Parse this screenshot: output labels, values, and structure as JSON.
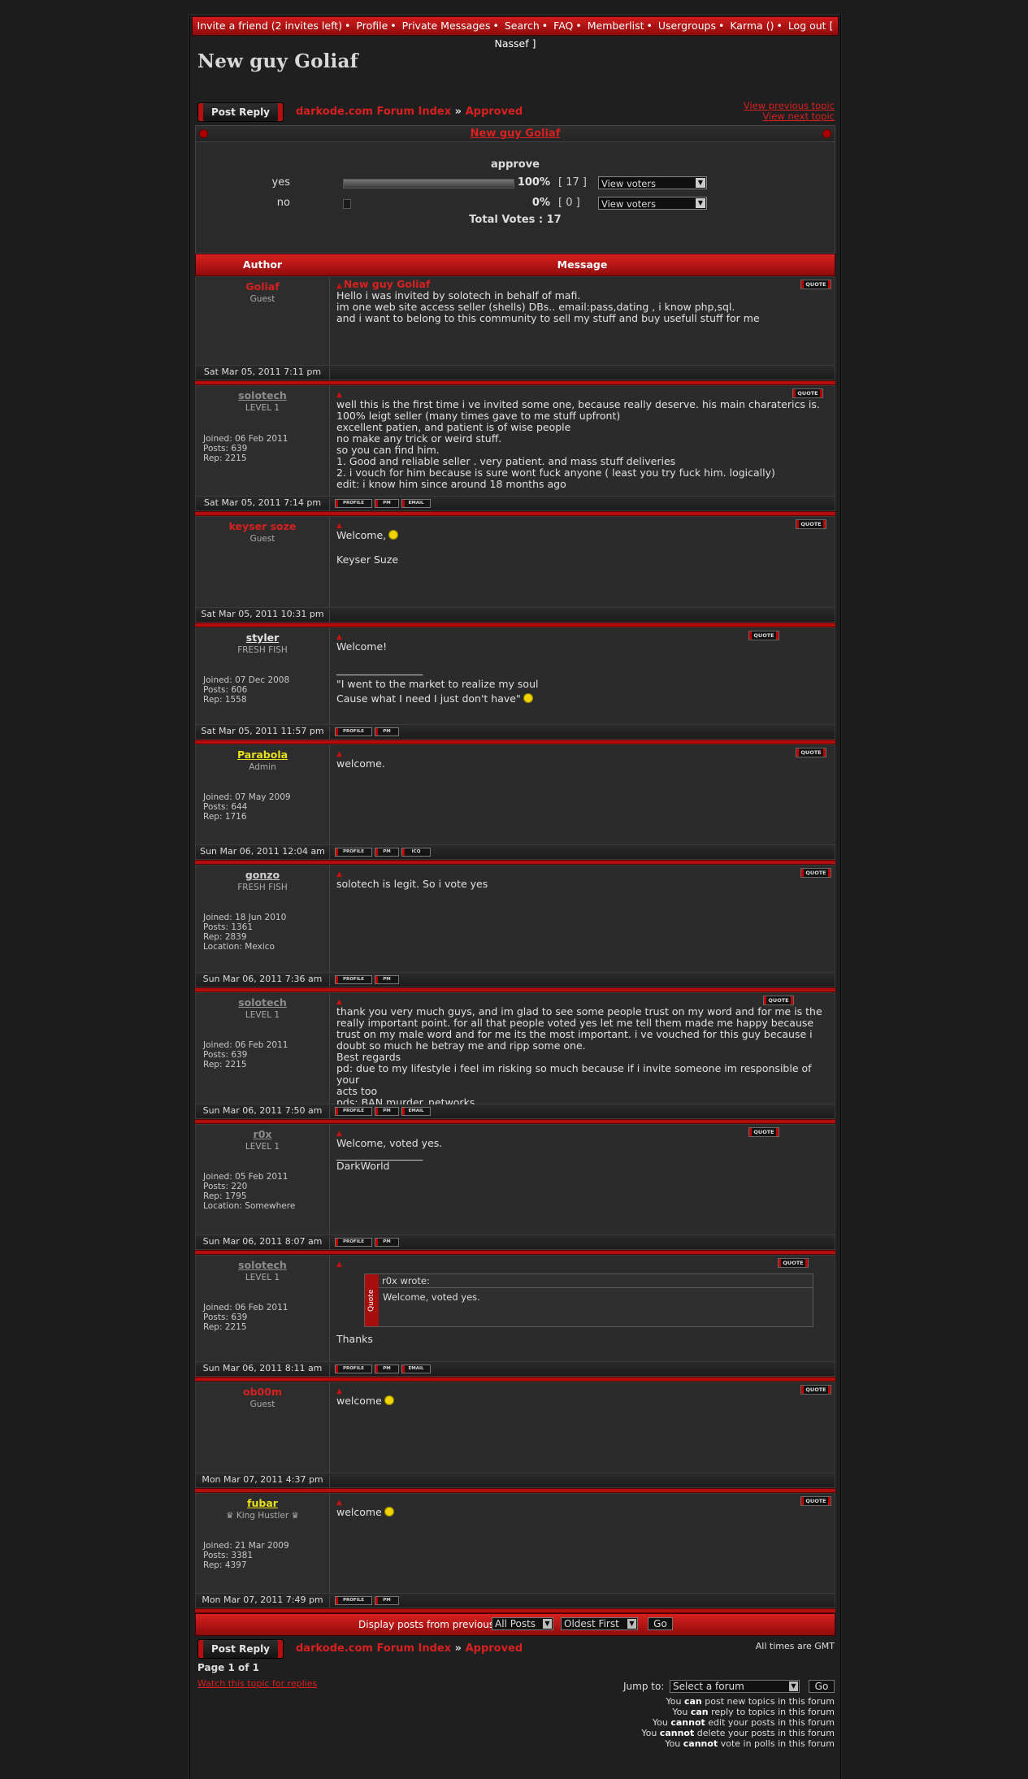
{
  "topnav": {
    "items": [
      "Invite a friend (2 invites left)",
      "Profile",
      "Private Messages",
      "Search",
      "FAQ",
      "Memberlist",
      "Usergroups",
      "Karma ()",
      "Log out [ Nassef ]"
    ]
  },
  "page": {
    "title": "New guy Goliaf",
    "post_reply_label": "Post Reply",
    "breadcrumb_index": "darkode.com Forum Index",
    "breadcrumb_sep": "»",
    "breadcrumb_forum": "Approved",
    "view_previous": "View previous topic",
    "view_next": "View next topic",
    "topic_title": "New guy Goliaf"
  },
  "poll": {
    "question": "approve",
    "options": [
      {
        "label": "yes",
        "percent_text": "100%",
        "percent": 100,
        "count": "[ 17 ]",
        "voters_label": "View voters"
      },
      {
        "label": "no",
        "percent_text": "0%",
        "percent": 0,
        "count": "[ 0 ]",
        "voters_label": "View voters"
      }
    ],
    "total": "Total Votes : 17"
  },
  "columns": {
    "author": "Author",
    "message": "Message"
  },
  "quote_label": "QUOTE",
  "profile_label": "PROFILE",
  "pm_label": "PM",
  "email_label": "EMAIL",
  "icq_label": "ICQ",
  "colors": {
    "accent": "#d72020",
    "admin": "#e8e01a",
    "grey_user": "#8c8c8c"
  },
  "posts": [
    {
      "author": "Goliaf",
      "rank": "Guest",
      "subject": "New guy Goliaf",
      "lines": [
        "Hello i was invited by solotech in behalf of mafi.",
        "im one web site access seller (shells) DBs.. email:pass,dating , i know php,sql.",
        "and i want to belong to this community to sell my stuff and buy usefull stuff for me"
      ],
      "date": "Sat Mar 05, 2011 7:11 pm"
    },
    {
      "author": "solotech",
      "rank": "LEVEL 1",
      "joined": "Joined: 06 Feb 2011",
      "posts": "Posts: 639",
      "rep": "Rep: 2215",
      "lines": [
        "well this is the first time i ve invited some one, because really deserve. his main charaterics is.",
        "100% leigt seller (many times gave to me stuff upfront)",
        "excellent patien, and patient is of wise people",
        "no make any trick or weird stuff.",
        "so you can find him.",
        "1. Good and reliable seller . very patient. and mass stuff deliveries",
        "2. i vouch for him because is sure wont fuck anyone ( least you try fuck him. logically)",
        "edit: i know him since around 18 months ago"
      ],
      "date": "Sat Mar 05, 2011 7:14 pm"
    },
    {
      "author": "keyser soze",
      "rank": "Guest",
      "lines": [
        "Welcome,",
        "Keyser Suze"
      ],
      "date": "Sat Mar 05, 2011 10:31 pm"
    },
    {
      "author": "styler",
      "rank": "FRESH FISH",
      "joined": "Joined: 07 Dec 2008",
      "posts": "Posts: 606",
      "rep": "Rep: 1558",
      "lines": [
        "Welcome!",
        "_________________",
        "\"I went to the market to realize my soul",
        "Cause what I need I just don't have\""
      ],
      "date": "Sat Mar 05, 2011 11:57 pm"
    },
    {
      "author": "Parabola",
      "rank": "Admin",
      "joined": "Joined: 07 May 2009",
      "posts": "Posts: 644",
      "rep": "Rep: 1716",
      "lines": [
        "welcome."
      ],
      "date": "Sun Mar 06, 2011 12:04 am"
    },
    {
      "author": "gonzo",
      "rank": "FRESH FISH",
      "joined": "Joined: 18 Jun 2010",
      "posts": "Posts: 1361",
      "rep": "Rep: 2839",
      "location": "Location: Mexico",
      "lines": [
        "solotech is legit. So i vote yes"
      ],
      "date": "Sun Mar 06, 2011 7:36 am"
    },
    {
      "author": "solotech",
      "rank": "LEVEL 1",
      "joined": "Joined: 06 Feb 2011",
      "posts": "Posts: 639",
      "rep": "Rep: 2215",
      "lines": [
        "thank you very much guys, and im glad to see some people trust on my word and for me is the",
        "really important point. for all that people voted yes let me tell them made me happy because",
        "trust on my male word and for me its the most important. i ve vouched for this guy because i",
        "doubt so much he betray me and ripp some one.",
        "Best regards",
        "pd: due to my lifestyle i feel im risking so much because if i invite someone im responsible of your",
        "acts too",
        "pds: BAN murder_networks"
      ],
      "date": "Sun Mar 06, 2011 7:50 am"
    },
    {
      "author": "r0x",
      "rank": "LEVEL 1",
      "joined": "Joined: 05 Feb 2011",
      "posts": "Posts: 220",
      "rep": "Rep: 1795",
      "location": "Location: Somewhere",
      "lines": [
        "Welcome, voted yes.",
        "_________________",
        "DarkWorld"
      ],
      "date": "Sun Mar 06, 2011 8:07 am"
    },
    {
      "author": "solotech",
      "rank": "LEVEL 1",
      "joined": "Joined: 06 Feb 2011",
      "posts": "Posts: 639",
      "rep": "Rep: 2215",
      "quote_tag": "Quote",
      "quote_head": "r0x wrote:",
      "quote_text": "Welcome, voted yes.",
      "lines": [
        "Thanks"
      ],
      "date": "Sun Mar 06, 2011 8:11 am"
    },
    {
      "author": "ob00m",
      "rank": "Guest",
      "lines": [
        "welcome"
      ],
      "date": "Mon Mar 07, 2011 4:37 pm"
    },
    {
      "author": "fubar",
      "rank": "♛ King Hustler ♛",
      "joined": "Joined: 21 Mar 2009",
      "posts": "Posts: 3381",
      "rep": "Rep: 4397",
      "lines": [
        "welcome"
      ],
      "date": "Mon Mar 07, 2011 7:49 pm"
    }
  ],
  "bottom": {
    "display_label": "Display posts from previous:",
    "all_posts": "All Posts",
    "oldest_first": "Oldest First",
    "go": "Go",
    "gmt": "All times are GMT",
    "page_of": "Page 1 of 1",
    "watch": "Watch this topic for replies",
    "jump_label": "Jump to:",
    "jump_select": "Select a forum",
    "jump_go": "Go",
    "perms": [
      {
        "a": "You ",
        "b": "can",
        "c": " post new topics in this forum"
      },
      {
        "a": "You ",
        "b": "can",
        "c": " reply to topics in this forum"
      },
      {
        "a": "You ",
        "b": "cannot",
        "c": " edit your posts in this forum"
      },
      {
        "a": "You ",
        "b": "cannot",
        "c": " delete your posts in this forum"
      },
      {
        "a": "You ",
        "b": "cannot",
        "c": " vote in polls in this forum"
      }
    ]
  }
}
